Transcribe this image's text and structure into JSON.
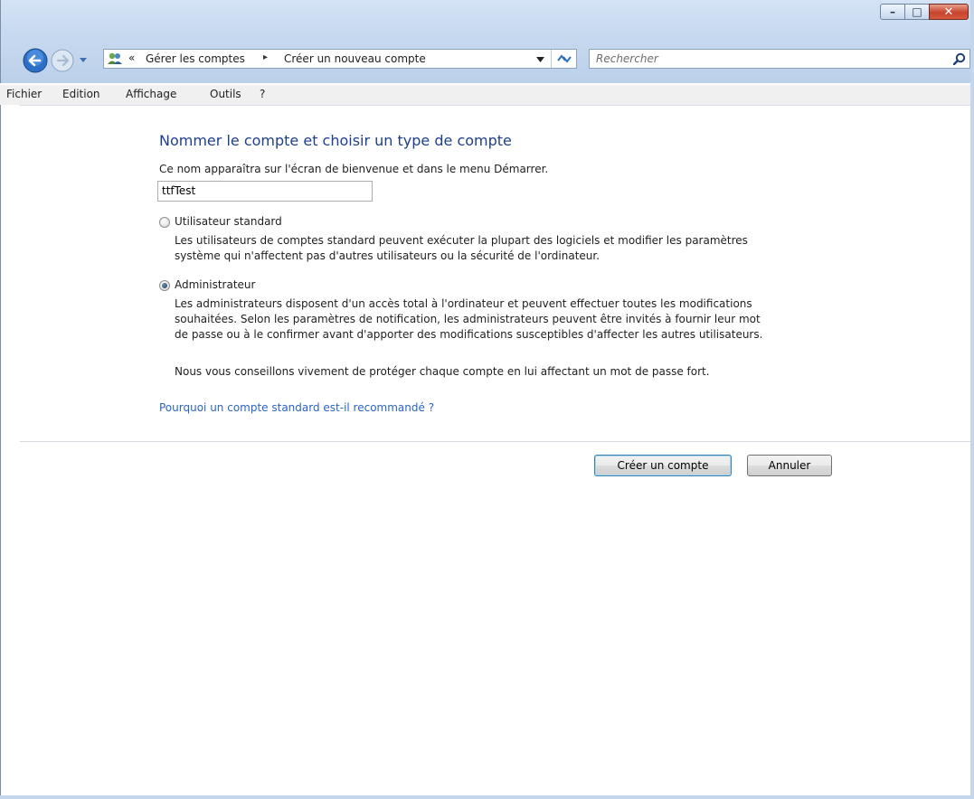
{
  "window": {
    "controls": {
      "minimize": "–",
      "maximize": "□",
      "close": "✕"
    }
  },
  "navigation": {
    "breadcrumb_prefix": "«",
    "breadcrumb": [
      "Gérer les comptes",
      "Créer un nouveau compte"
    ],
    "breadcrumb_separator": "▸",
    "search_placeholder": "Rechercher"
  },
  "menu": [
    "Fichier",
    "Edition",
    "Affichage",
    "Outils",
    "?"
  ],
  "main": {
    "heading": "Nommer le compte et choisir un type de compte",
    "name_prompt": "Ce nom apparaîtra sur l'écran de bienvenue et dans le menu Démarrer.",
    "name_value": "ttfTest",
    "options": [
      {
        "label": "Utilisateur standard",
        "selected": false,
        "description": [
          "Les utilisateurs de comptes standard peuvent exécuter la plupart des logiciels et modifier les paramètres",
          "système qui n'affectent pas d'autres utilisateurs ou la sécurité de l'ordinateur."
        ]
      },
      {
        "label": "Administrateur",
        "selected": true,
        "description": [
          "Les administrateurs disposent d'un accès total à l'ordinateur et peuvent effectuer toutes les modifications",
          "souhaitées. Selon les paramètres de notification, les administrateurs peuvent être invités à fournir leur mot",
          "de passe ou à le confirmer avant d'apporter des modifications susceptibles d'affecter les autres utilisateurs."
        ]
      }
    ],
    "advice": "Nous vous conseillons vivement de protéger chaque compte en lui affectant un mot de passe fort.",
    "help_link": "Pourquoi un compte standard est-il recommandé ?"
  },
  "buttons": {
    "create": "Créer un compte",
    "cancel": "Annuler"
  },
  "colors": {
    "heading": "#1e3f8a",
    "link": "#2a64c4",
    "titlebar": "#c3d6ee"
  }
}
